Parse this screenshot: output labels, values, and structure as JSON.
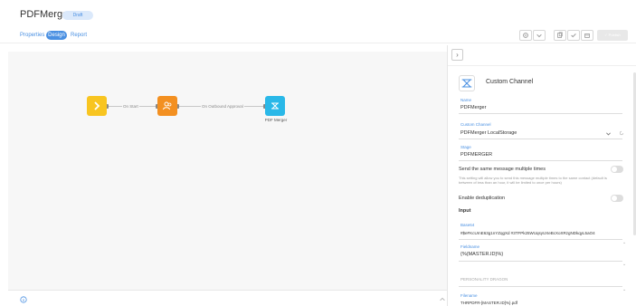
{
  "app": {
    "title": "PDFMerger",
    "status_badge": "Draft"
  },
  "tabs": [
    {
      "label": "Properties",
      "active": false
    },
    {
      "label": "Design",
      "active": true
    },
    {
      "label": "Report",
      "active": false
    }
  ],
  "toolbar": {
    "icons": [
      "settings-icon",
      "chevron-down-icon",
      "copy-icon",
      "check-icon",
      "calendar-icon"
    ],
    "save_label": "✓ Publish"
  },
  "workflow": {
    "nodes": [
      {
        "id": "start",
        "icon": "chevron-right-icon",
        "color": "#f8c521"
      },
      {
        "id": "review",
        "icon": "users-icon",
        "color": "#f39021"
      },
      {
        "id": "channel",
        "icon": "custom-channel-icon",
        "color": "#2ab8e8",
        "caption": "PDF Merger"
      }
    ],
    "connections": [
      {
        "label": "On Start"
      },
      {
        "label": "On Outbound Approval"
      }
    ]
  },
  "panel": {
    "collapse_glyph": "›",
    "channel_title": "Custom Channel",
    "fields": {
      "name": {
        "label": "Name",
        "value": "PDFMerger"
      },
      "custom_channel": {
        "label": "Custom Channel",
        "value": "PDFMerger LocalStorage"
      },
      "stage": {
        "label": "Stage",
        "value": "PDFMERGER"
      },
      "send_same_message": {
        "label": "Send the same message multiple times",
        "help": "This setting will allow you to send this message multiple times to the same contact (default is between of less than an hour, it will be limited to once per hours)"
      },
      "enable_deduplication": {
        "label": "Enable deduplication"
      },
      "input": {
        "label": "Input",
        "items": [
          {
            "label": "Base64",
            "value": "#$eFKcUrnE63g1nYZqgXd #3TFPk25WUqsyUXeBcXoXRzgNDkqyL5aO4"
          },
          {
            "label": "Fieldname",
            "value": "{%{MASTER.ID}%}"
          },
          {
            "label": "PERSONALITY DRAGON",
            "value": ""
          },
          {
            "label": "Filename",
            "value": "THRPDFR-[MASTER.ID]%}.pdf"
          }
        ]
      }
    }
  }
}
